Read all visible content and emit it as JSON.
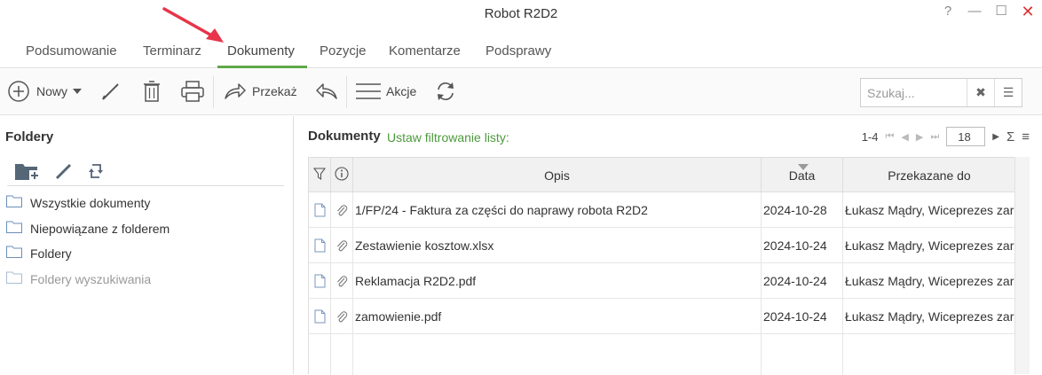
{
  "window": {
    "title": "Robot R2D2",
    "controls": {
      "help": "?",
      "minimize": "—",
      "maximize": "☐",
      "close": "✕"
    }
  },
  "tabs": [
    {
      "label": "Podsumowanie"
    },
    {
      "label": "Terminarz"
    },
    {
      "label": "Dokumenty",
      "active": true
    },
    {
      "label": "Pozycje"
    },
    {
      "label": "Komentarze"
    },
    {
      "label": "Podsprawy"
    }
  ],
  "toolbar": {
    "new_label": "Nowy",
    "forward_label": "Przekaż",
    "actions_label": "Akcje",
    "icons": [
      "plus-circle-icon",
      "pencil-icon",
      "trash-icon",
      "printer-icon",
      "forward-arrow-icon",
      "reply-arrow-icon",
      "hamburger-icon",
      "refresh-icon"
    ]
  },
  "search": {
    "placeholder": "Szukaj...",
    "clear_icon": "✖",
    "menu_icon": "☰"
  },
  "folders": {
    "title": "Foldery",
    "items": [
      {
        "label": "Wszystkie dokumenty",
        "muted": false
      },
      {
        "label": "Niepowiązane z folderem",
        "muted": false
      },
      {
        "label": "Foldery",
        "muted": false
      },
      {
        "label": "Foldery wyszukiwania",
        "muted": true
      }
    ]
  },
  "documents": {
    "title": "Dokumenty",
    "filter_link": "Ustaw filtrowanie listy:",
    "range": "1-4",
    "page_size": "18",
    "columns": {
      "opis": "Opis",
      "data": "Data",
      "przekazane": "Przekazane do"
    },
    "rows": [
      {
        "opis": "1/FP/24 - Faktura za części do naprawy robota R2D2",
        "data": "2024-10-28",
        "przekazane": "Łukasz Mądry, Wiceprezes zar"
      },
      {
        "opis": "Zestawienie kosztow.xlsx",
        "data": "2024-10-24",
        "przekazane": "Łukasz Mądry, Wiceprezes zar"
      },
      {
        "opis": "Reklamacja R2D2.pdf",
        "data": "2024-10-24",
        "przekazane": "Łukasz Mądry, Wiceprezes zar"
      },
      {
        "opis": "zamowienie.pdf",
        "data": "2024-10-24",
        "przekazane": "Łukasz Mądry, Wiceprezes zar"
      }
    ]
  },
  "colors": {
    "accent_green": "#5fa84b",
    "filter_green": "#4c9a3b",
    "annotation_arrow": "#e8344a",
    "close_red": "#dd3333"
  }
}
